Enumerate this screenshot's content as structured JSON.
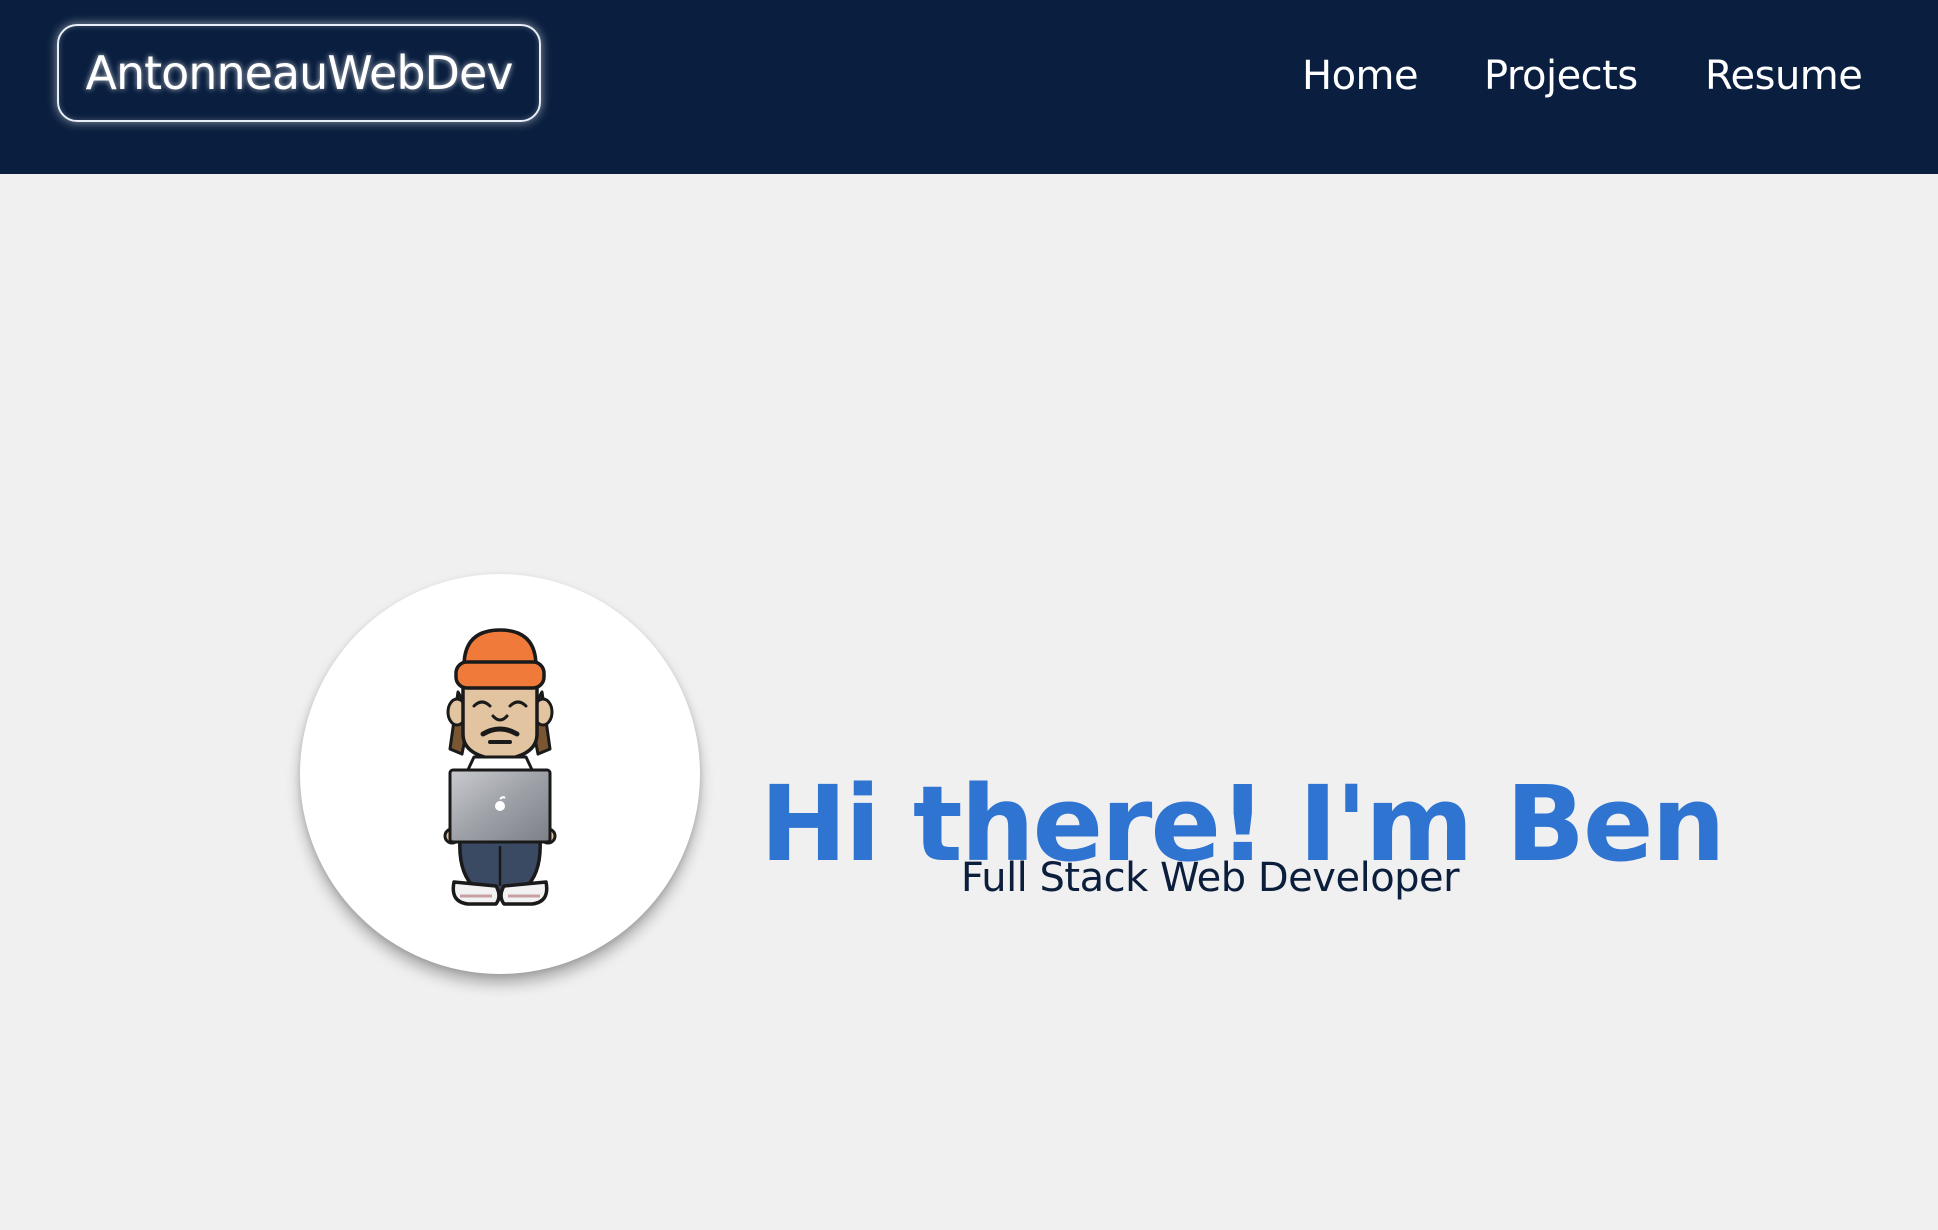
{
  "colors": {
    "nav_background": "#0a1f3f",
    "page_background": "#f0f0f1",
    "accent_blue": "#2f74d0",
    "subtitle_navy": "#0b1f3d",
    "beanie_orange": "#f07a3a"
  },
  "navbar": {
    "brand": "AntonneauWebDev",
    "links": [
      {
        "label": "Home"
      },
      {
        "label": "Projects"
      },
      {
        "label": "Resume"
      }
    ]
  },
  "hero": {
    "avatar_icon": "developer-avatar-with-laptop",
    "title": "Hi there! I'm Ben",
    "subtitle": "Full Stack Web Developer"
  }
}
